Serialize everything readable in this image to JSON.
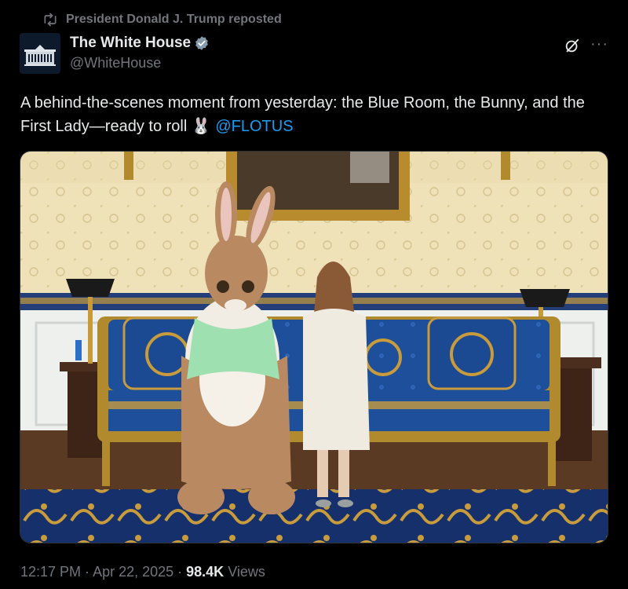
{
  "repost": {
    "text": "President Donald J. Trump reposted",
    "icon": "repost-icon"
  },
  "author": {
    "name": "The White House",
    "handle": "@WhiteHouse",
    "verified_color": "#829aab",
    "avatar_icon": "white-house-logo-icon"
  },
  "header_actions": {
    "grok_icon": "grok-icon",
    "more_label": "···"
  },
  "tweet": {
    "text_before": "A behind-the-scenes moment from yesterday: the Blue Room, the Bunny, and the First Lady—ready to roll ",
    "emoji": "🐰",
    "mention": "@FLOTUS"
  },
  "media": {
    "type": "photo",
    "subject": "blue-room-easter-bunny-photo"
  },
  "meta": {
    "time": "12:17 PM",
    "sep1": " · ",
    "date": "Apr 22, 2025",
    "sep2": " · ",
    "views_count": "98.4K",
    "views_label": " Views"
  },
  "colors": {
    "background": "#000000",
    "text": "#e7e9ea",
    "muted": "#71767b",
    "link": "#1d9bf0"
  }
}
